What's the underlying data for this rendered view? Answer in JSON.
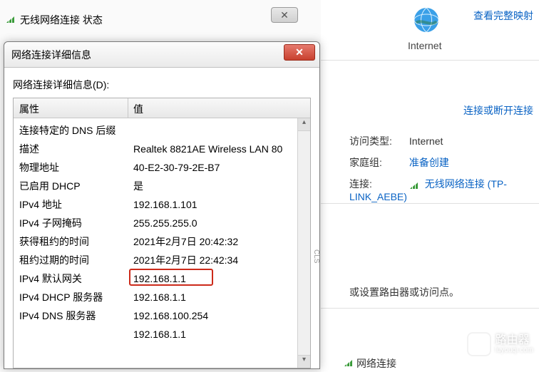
{
  "status_window": {
    "title": "无线网络连接 状态",
    "close_x": "✕"
  },
  "details_window": {
    "title": "网络连接详细信息",
    "close_x": "✕",
    "list_label": "网络连接详细信息(D):",
    "header_property": "属性",
    "header_value": "值",
    "rows": [
      {
        "p": "连接特定的 DNS 后缀",
        "v": ""
      },
      {
        "p": "描述",
        "v": "Realtek 8821AE Wireless LAN 80"
      },
      {
        "p": "物理地址",
        "v": "40-E2-30-79-2E-B7"
      },
      {
        "p": "已启用 DHCP",
        "v": "是"
      },
      {
        "p": "IPv4 地址",
        "v": "192.168.1.101"
      },
      {
        "p": "IPv4 子网掩码",
        "v": "255.255.255.0"
      },
      {
        "p": "获得租约的时间",
        "v": "2021年2月7日 20:42:32"
      },
      {
        "p": "租约过期的时间",
        "v": "2021年2月7日 22:42:34"
      },
      {
        "p": "IPv4 默认网关",
        "v": "192.168.1.1"
      },
      {
        "p": "IPv4 DHCP 服务器",
        "v": "192.168.1.1"
      },
      {
        "p": "IPv4 DNS 服务器",
        "v": "192.168.100.254"
      },
      {
        "p": "",
        "v": "192.168.1.1"
      }
    ],
    "side_label": "CLS"
  },
  "right": {
    "internet": "Internet",
    "view_full_map": "查看完整映射",
    "connect_or_disconnect": "连接或断开连接",
    "access_type_label": "访问类型:",
    "access_type_value": "Internet",
    "homegroup_label": "家庭组:",
    "homegroup_value": "准备创建",
    "connections_label": "连接:",
    "connections_value": "无线网络连接 (TP-LINK_AEBE)",
    "router_hint": "或设置路由器或访问点。",
    "bottom_text": "网络连接"
  },
  "watermark": {
    "title": "路由器",
    "sub": "luyouqi.com"
  }
}
